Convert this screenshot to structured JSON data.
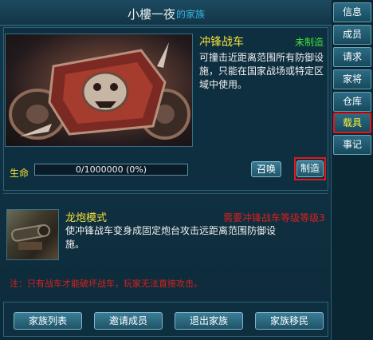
{
  "title": {
    "name": "小樓一夜",
    "suffix": "的家族"
  },
  "side_tabs": [
    "信息",
    "成员",
    "请求",
    "家将",
    "仓库",
    "载具",
    "事记"
  ],
  "selected_tab": "载具",
  "vehicle": {
    "name": "冲锋战车",
    "status": "未制造",
    "description": "可撞击近距离范围所有防御设施，只能在国家战场或特定区域中使用。",
    "hp_label": "生命",
    "hp_text": "0/1000000 (0%)",
    "hp_fraction": 0,
    "summon_label": "召唤",
    "make_label": "制造"
  },
  "skill": {
    "name": "龙炮模式",
    "requirement": "需要冲锋战车等级等级3",
    "description": "使冲锋战车变身成固定炮台攻击远距离范围防御设施。"
  },
  "note": "注：只有战车才能破坏战车，玩家无法直接攻击。",
  "bottom_buttons": [
    "家族列表",
    "邀请成员",
    "退出家族",
    "家族移民"
  ],
  "colors": {
    "accent_yellow": "#f2e23a",
    "status_green": "#42e43a",
    "warning_red": "#d8201e",
    "highlight_border": "#e2161b"
  }
}
